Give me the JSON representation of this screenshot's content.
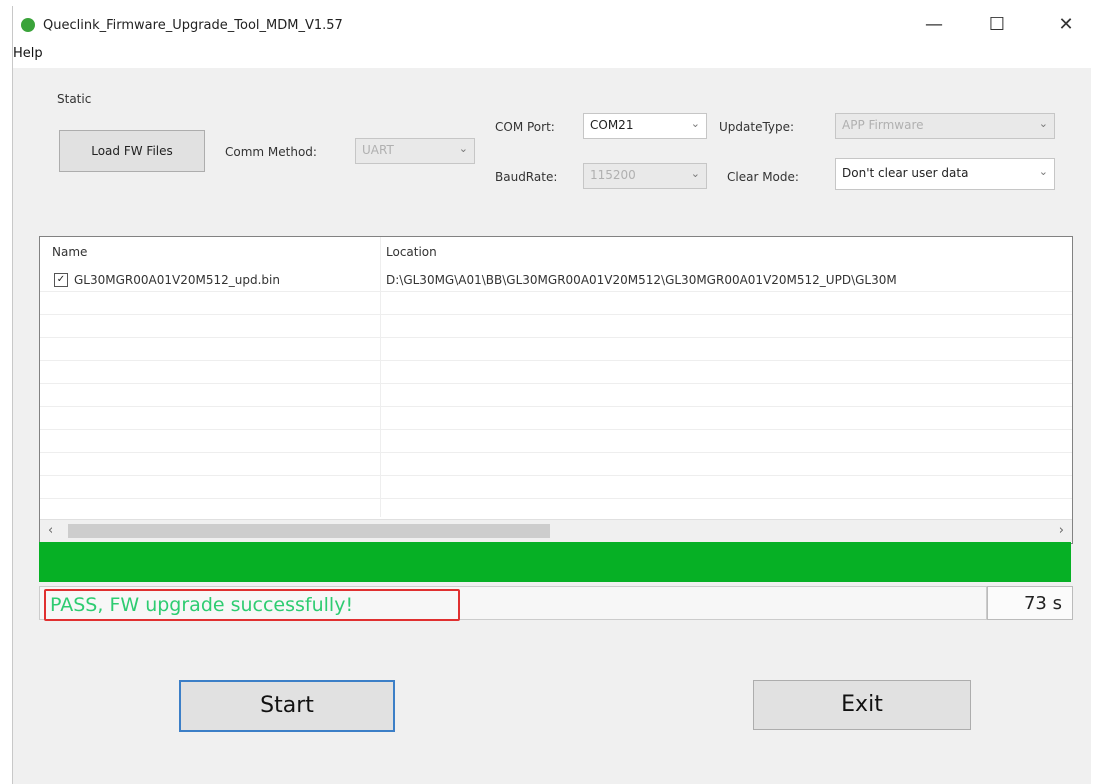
{
  "window": {
    "title": "Queclink_Firmware_Upgrade_Tool_MDM_V1.57",
    "controls": {
      "minimize": "—",
      "maximize": "☐",
      "close": "✕"
    }
  },
  "menu": {
    "help": "Help"
  },
  "static_group": {
    "label": "Static",
    "load_button": "Load FW Files",
    "comm_method_label": "Comm Method:",
    "comm_method_value": "UART",
    "com_port_label": "COM Port:",
    "com_port_value": "COM21",
    "baud_rate_label": "BaudRate:",
    "baud_rate_value": "115200",
    "update_type_label": "UpdateType:",
    "update_type_value": "APP Firmware",
    "clear_mode_label": "Clear Mode:",
    "clear_mode_value": "Don't clear user data"
  },
  "file_list": {
    "columns": {
      "name": "Name",
      "location": "Location"
    },
    "rows": [
      {
        "checked": true,
        "name": "GL30MGR00A01V20M512_upd.bin",
        "location": "D:\\GL30MG\\A01\\BB\\GL30MGR00A01V20M512\\GL30MGR00A01V20M512_UPD\\GL30M"
      }
    ]
  },
  "progress": {
    "percent": 100,
    "color": "#06b025"
  },
  "status": {
    "message": "PASS, FW upgrade successfully!",
    "elapsed": "73 s"
  },
  "actions": {
    "start": "Start",
    "exit": "Exit"
  }
}
